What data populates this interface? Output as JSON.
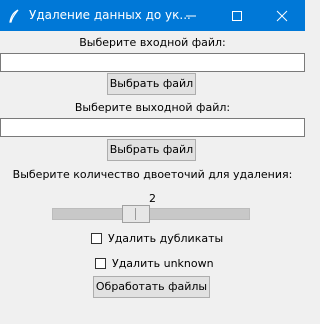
{
  "window": {
    "title": "Удаление данных до ук...",
    "minimize_icon": "minimize-icon",
    "maximize_icon": "maximize-icon",
    "close_icon": "close-icon",
    "app_icon": "feather-icon"
  },
  "form": {
    "input_label": "Выберите входной файл:",
    "input_value": "",
    "input_button": "Выбрать файл",
    "output_label": "Выберите выходной файл:",
    "output_value": "",
    "output_button": "Выбрать файл",
    "colons_label": "Выберите количество двоеточий для удаления:",
    "colons_value": "2",
    "remove_duplicates_label": "Удалить дубликаты",
    "remove_duplicates_checked": false,
    "remove_unknown_label": "Удалить unknown",
    "remove_unknown_checked": false,
    "process_button": "Обработать файлы"
  },
  "colors": {
    "titlebar": "#0078d7",
    "background": "#f0f0f0",
    "button": "#e1e1e1"
  }
}
